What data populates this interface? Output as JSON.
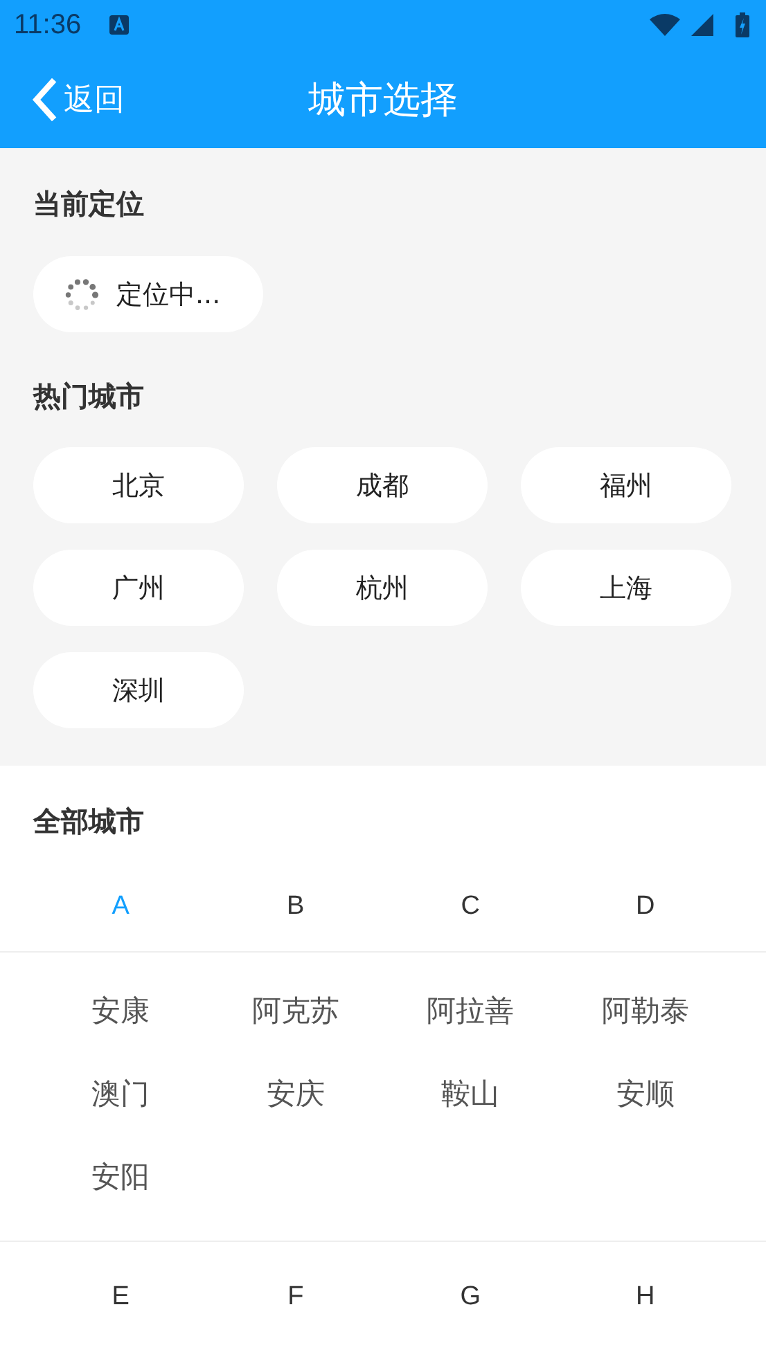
{
  "status_bar": {
    "time": "11:36"
  },
  "header": {
    "back": "返回",
    "title": "城市选择"
  },
  "current_location": {
    "title": "当前定位",
    "status": "定位中..."
  },
  "hot_cities": {
    "title": "热门城市",
    "cities": [
      "北京",
      "成都",
      "福州",
      "广州",
      "杭州",
      "上海",
      "深圳"
    ]
  },
  "all_cities": {
    "title": "全部城市",
    "groups": [
      {
        "letters": [
          {
            "label": "A",
            "selected": true
          },
          {
            "label": "B",
            "selected": false
          },
          {
            "label": "C",
            "selected": false
          },
          {
            "label": "D",
            "selected": false
          }
        ],
        "cities": [
          "安康",
          "阿克苏",
          "阿拉善",
          "阿勒泰",
          "澳门",
          "安庆",
          "鞍山",
          "安顺",
          "安阳"
        ]
      },
      {
        "letters": [
          {
            "label": "E",
            "selected": false
          },
          {
            "label": "F",
            "selected": false
          },
          {
            "label": "G",
            "selected": false
          },
          {
            "label": "H",
            "selected": false
          }
        ]
      }
    ]
  }
}
